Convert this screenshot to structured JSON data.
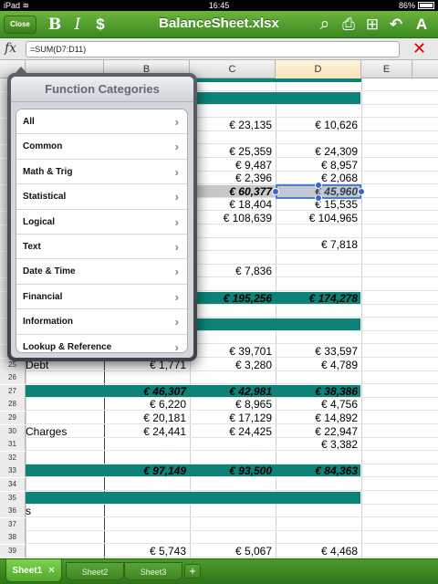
{
  "status_bar": {
    "device": "iPad",
    "wifi": "≋",
    "time": "16:45",
    "battery": "86%"
  },
  "toolbar": {
    "close_label": "Close",
    "bold_glyph": "B",
    "italic_glyph": "I",
    "currency_glyph": "$",
    "title": "BalanceSheet.xlsx",
    "search_glyph": "⌕",
    "print_glyph": "⎙",
    "insert_glyph": "⊞",
    "undo_glyph": "↶",
    "format_glyph": "A"
  },
  "formula_bar": {
    "fx_label": "fx",
    "value": "=SUM(D7:D11)",
    "cancel_glyph": "✕"
  },
  "columns": [
    "B",
    "C",
    "D",
    "E"
  ],
  "rows": [
    {
      "n": "",
      "a": "",
      "b": "",
      "c": "",
      "d": "",
      "style": "partial"
    },
    {
      "n": "",
      "a": "",
      "b": "",
      "c": "",
      "d": "",
      "style": "teal"
    },
    {
      "n": "",
      "a": "",
      "b": "",
      "c": "",
      "d": ""
    },
    {
      "n": "",
      "a": "",
      "b": "",
      "c": "€ 23,135",
      "d": "€ 10,626"
    },
    {
      "n": "",
      "a": "",
      "b": "",
      "c": "",
      "d": ""
    },
    {
      "n": "",
      "a": "",
      "b": "",
      "c": "€ 25,359",
      "d": "€ 24,309"
    },
    {
      "n": "",
      "a": "",
      "b": "",
      "c": "€ 9,487",
      "d": "€ 8,957"
    },
    {
      "n": "",
      "a": "",
      "b": "",
      "c": "€ 2,396",
      "d": "€ 2,068"
    },
    {
      "n": "",
      "a": "",
      "b": "",
      "c": "€ 60,377",
      "d": "€ 45,960",
      "style": "selected"
    },
    {
      "n": "",
      "a": "",
      "b": "",
      "c": "€ 18,404",
      "d": "€ 15,535"
    },
    {
      "n": "",
      "a": "",
      "b": "",
      "c": "€ 108,639",
      "d": "€ 104,965"
    },
    {
      "n": "",
      "a": "",
      "b": "",
      "c": "",
      "d": ""
    },
    {
      "n": "",
      "a": "",
      "b": "",
      "c": "",
      "d": "€ 7,818"
    },
    {
      "n": "",
      "a": "",
      "b": "",
      "c": "",
      "d": ""
    },
    {
      "n": "",
      "a": "",
      "b": "",
      "c": "€ 7,836",
      "d": ""
    },
    {
      "n": "",
      "a": "",
      "b": "",
      "c": "",
      "d": ""
    },
    {
      "n": "",
      "a": "",
      "b": "",
      "c": "€ 195,256",
      "d": "€ 174,278",
      "style": "total"
    },
    {
      "n": "",
      "a": "",
      "b": "",
      "c": "",
      "d": ""
    },
    {
      "n": "",
      "a": "",
      "b": "",
      "c": "",
      "d": "",
      "style": "teal"
    },
    {
      "n": "",
      "a": "",
      "b": "",
      "c": "",
      "d": ""
    },
    {
      "n": "",
      "a": "",
      "b": "",
      "c": "€ 39,701",
      "d": "€ 33,597"
    },
    {
      "n": "25",
      "a": "Debt",
      "b": "€ 1,771",
      "c": "€ 3,280",
      "d": "€ 4,789"
    },
    {
      "n": "26",
      "a": "",
      "b": "",
      "c": "",
      "d": ""
    },
    {
      "n": "27",
      "a": "",
      "b": "€ 46,307",
      "c": "€ 42,981",
      "d": "€ 38,386",
      "style": "total"
    },
    {
      "n": "28",
      "a": "",
      "b": "€ 6,220",
      "c": "€ 8,965",
      "d": "€ 4,756"
    },
    {
      "n": "29",
      "a": "",
      "b": "€ 20,181",
      "c": "€ 17,129",
      "d": "€ 14,892"
    },
    {
      "n": "30",
      "a": "Charges",
      "b": "€ 24,441",
      "c": "€ 24,425",
      "d": "€ 22,947"
    },
    {
      "n": "31",
      "a": "",
      "b": "",
      "c": "",
      "d": "€ 3,382"
    },
    {
      "n": "32",
      "a": "",
      "b": "",
      "c": "",
      "d": ""
    },
    {
      "n": "33",
      "a": "",
      "b": "€ 97,149",
      "c": "€ 93,500",
      "d": "€ 84,363",
      "style": "total"
    },
    {
      "n": "34",
      "a": "",
      "b": "",
      "c": "",
      "d": ""
    },
    {
      "n": "35",
      "a": "",
      "b": "",
      "c": "",
      "d": "",
      "style": "teal"
    },
    {
      "n": "36",
      "a": "s",
      "b": "",
      "c": "",
      "d": ""
    },
    {
      "n": "37",
      "a": "",
      "b": "",
      "c": "",
      "d": ""
    },
    {
      "n": "38",
      "a": "",
      "b": "",
      "c": "",
      "d": ""
    },
    {
      "n": "39",
      "a": "",
      "b": "€ 5,743",
      "c": "€ 5,067",
      "d": "€ 4,468"
    }
  ],
  "popover": {
    "title": "Function Categories",
    "items": [
      "All",
      "Common",
      "Math & Trig",
      "Statistical",
      "Logical",
      "Text",
      "Date & Time",
      "Financial",
      "Information",
      "Lookup & Reference"
    ],
    "chevron": "›"
  },
  "sheets": {
    "tabs": [
      "Sheet1",
      "Sheet2",
      "Sheet3"
    ],
    "active": "Sheet1",
    "close_glyph": "✕",
    "add_glyph": "+"
  }
}
